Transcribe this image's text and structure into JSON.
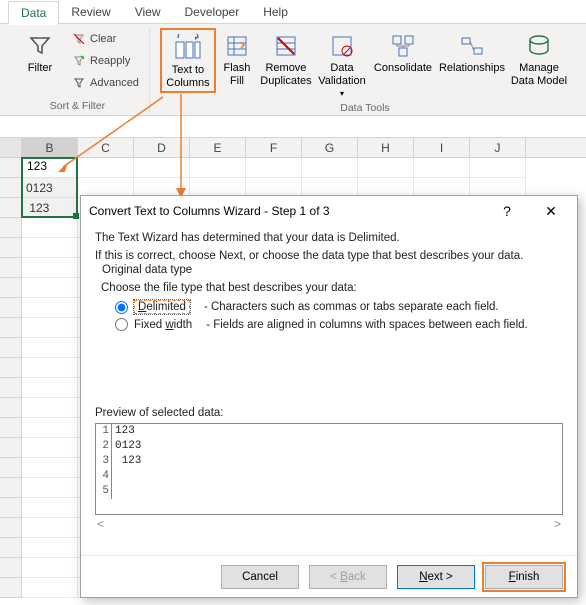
{
  "tabs": [
    "Data",
    "Review",
    "View",
    "Developer",
    "Help"
  ],
  "active_tab": 0,
  "ribbon": {
    "sort_filter": {
      "filter": "Filter",
      "clear": "Clear",
      "reapply": "Reapply",
      "advanced": "Advanced",
      "group_label": "Sort & Filter"
    },
    "data_tools": {
      "text_to_columns": "Text to\nColumns",
      "flash_fill": "Flash\nFill",
      "remove_duplicates": "Remove\nDuplicates",
      "data_validation": "Data\nValidation",
      "consolidate": "Consolidate",
      "relationships": "Relationships",
      "manage_data_model": "Manage\nData Model",
      "group_label": "Data Tools"
    }
  },
  "columns": [
    "B",
    "C",
    "D",
    "E",
    "F",
    "G",
    "H",
    "I",
    "J"
  ],
  "selected_col": "B",
  "cells": {
    "B": [
      "123",
      "0123",
      " 123"
    ]
  },
  "dialog": {
    "title": "Convert Text to Columns Wizard - Step 1 of 3",
    "line1": "The Text Wizard has determined that your data is Delimited.",
    "line2": "If this is correct, choose Next, or choose the data type that best describes your data.",
    "legend": "Original data type",
    "prompt": "Choose the file type that best describes your data:",
    "radio_delimited": "Delimited",
    "radio_delimited_desc": "- Characters such as commas or tabs separate each field.",
    "radio_fixed": "Fixed width",
    "radio_fixed_desc": "- Fields are aligned in columns with spaces between each field.",
    "preview_label": "Preview of selected data:",
    "preview_rows": [
      {
        "n": "1",
        "v": "123"
      },
      {
        "n": "2",
        "v": "0123"
      },
      {
        "n": "3",
        "v": " 123"
      },
      {
        "n": "4",
        "v": ""
      },
      {
        "n": "5",
        "v": ""
      }
    ],
    "buttons": {
      "cancel": "Cancel",
      "back": "< Back",
      "next": "Next >",
      "finish": "Finish"
    }
  }
}
